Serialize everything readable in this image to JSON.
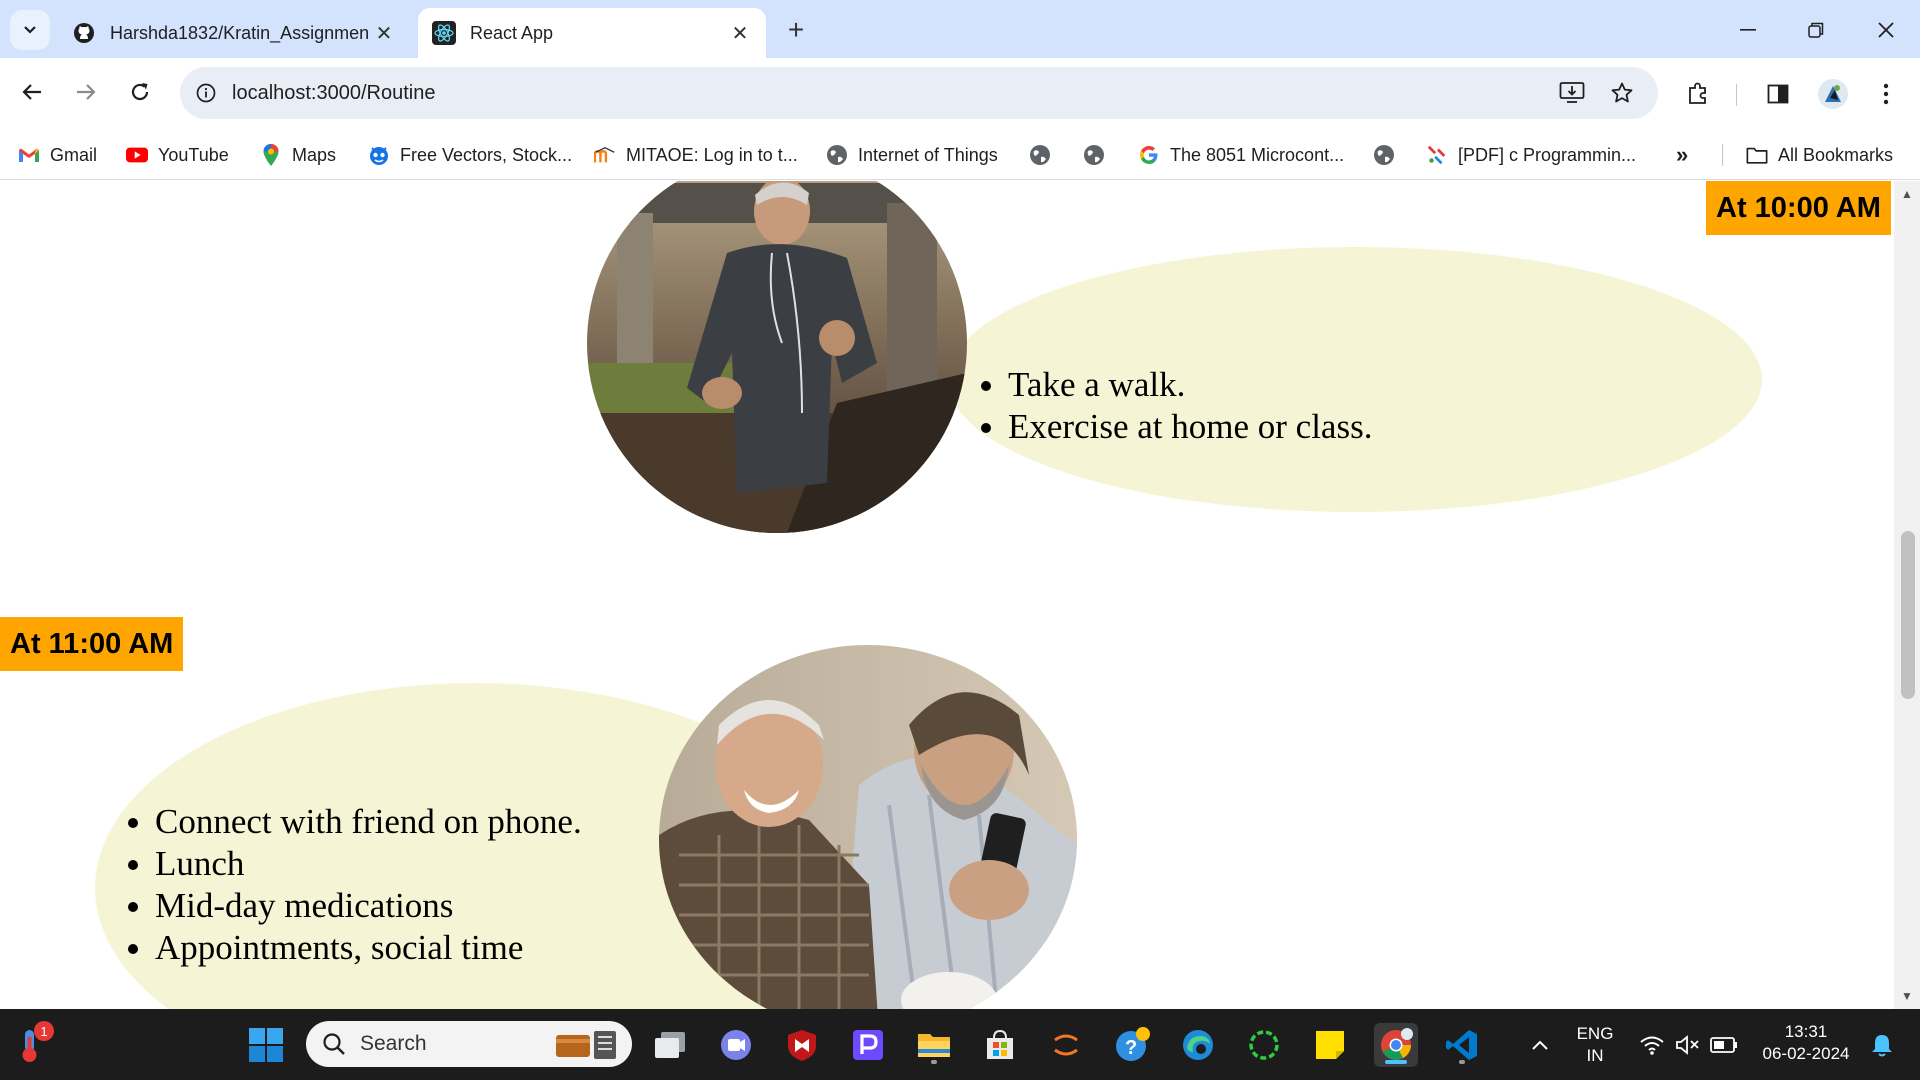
{
  "browser": {
    "tabs": [
      {
        "title": "Harshda1832/Kratin_Assignmen",
        "icon": "github-icon",
        "active": false
      },
      {
        "title": "React App",
        "icon": "react-icon",
        "active": true
      }
    ],
    "url": "localhost:3000/Routine",
    "bookmarks": [
      {
        "label": "Gmail",
        "icon": "gmail-icon"
      },
      {
        "label": "YouTube",
        "icon": "youtube-icon"
      },
      {
        "label": "Maps",
        "icon": "maps-icon"
      },
      {
        "label": "Free Vectors, Stock...",
        "icon": "freepik-icon"
      },
      {
        "label": "MITAOE: Log in to t...",
        "icon": "moodle-icon"
      },
      {
        "label": "Internet of Things",
        "icon": "globe-icon"
      },
      {
        "label": "",
        "icon": "globe-icon"
      },
      {
        "label": "",
        "icon": "globe-icon"
      },
      {
        "label": "The 8051 Microcont...",
        "icon": "google-icon"
      },
      {
        "label": "",
        "icon": "globe-icon"
      },
      {
        "label": "[PDF] c Programmin...",
        "icon": "pdf-bookmark-icon"
      }
    ],
    "all_bookmarks_label": "All Bookmarks"
  },
  "page": {
    "sections": [
      {
        "time": "At 10:00 AM",
        "items": [
          "Take a walk.",
          "Exercise at home or class."
        ],
        "image": "man-jogging-photo"
      },
      {
        "time": "At 11:00 AM",
        "items": [
          "Connect with friend on phone.",
          "Lunch",
          "Mid-day medications",
          "Appointments, social time"
        ],
        "image": "friends-on-phone-photo"
      }
    ],
    "colors": {
      "badge": "#ffa500",
      "blob": "#f5f5d5"
    }
  },
  "taskbar": {
    "search_placeholder": "Search",
    "weather_badge": "1",
    "language": "ENG",
    "region": "IN",
    "time": "13:31",
    "date": "06-02-2024"
  }
}
